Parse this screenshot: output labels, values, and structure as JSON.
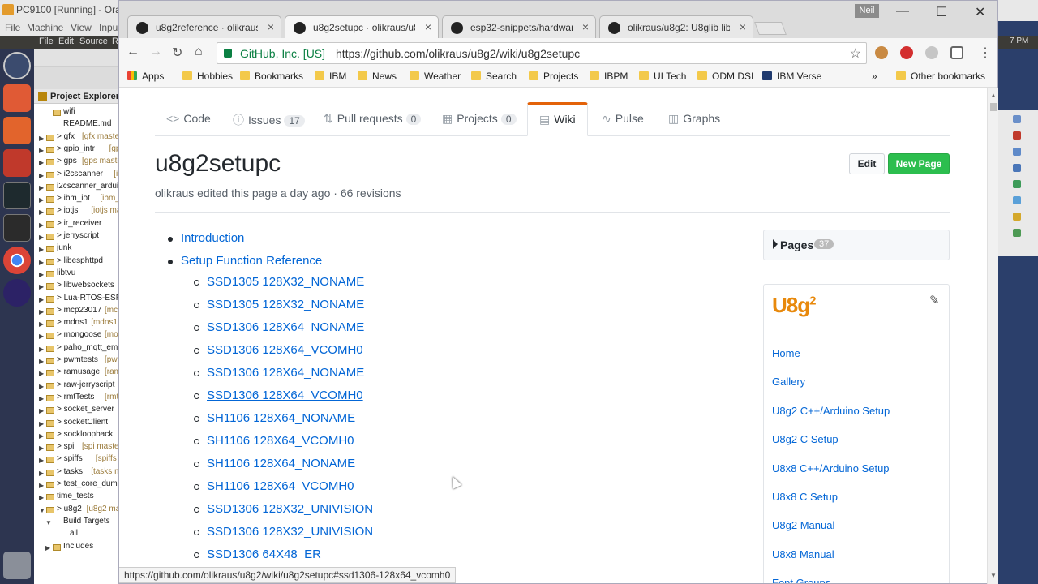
{
  "vm": {
    "title": "PC9100 [Running] - Ora",
    "menu": [
      "File",
      "Machine",
      "View",
      "Inpu"
    ]
  },
  "ubuntu_topbar": {
    "menu": [
      "File",
      "Edit",
      "Source",
      "R"
    ],
    "time": "7 PM"
  },
  "project_explorer": {
    "title": "Project Explorer",
    "items": [
      {
        "indent": 1,
        "twisty": "",
        "label": "wifi",
        "decoration": "",
        "folder": true
      },
      {
        "indent": 1,
        "twisty": "",
        "label": "README.md",
        "decoration": "",
        "folder": false
      },
      {
        "indent": 0,
        "twisty": ">",
        "label": "> gfx",
        "decoration": "[gfx master",
        "folder": true
      },
      {
        "indent": 0,
        "twisty": ">",
        "label": "> gpio_intr",
        "decoration": "[gpio",
        "folder": true
      },
      {
        "indent": 0,
        "twisty": ">",
        "label": "> gps",
        "decoration": "[gps maste",
        "folder": true
      },
      {
        "indent": 0,
        "twisty": ">",
        "label": "> i2cscanner",
        "decoration": "[i2c",
        "folder": true
      },
      {
        "indent": 0,
        "twisty": ">",
        "label": "i2cscanner_ardui",
        "decoration": "",
        "folder": true
      },
      {
        "indent": 0,
        "twisty": ">",
        "label": "> ibm_iot",
        "decoration": "[ibm_io",
        "folder": true
      },
      {
        "indent": 0,
        "twisty": ">",
        "label": "> iotjs",
        "decoration": "[iotjs mast",
        "folder": true
      },
      {
        "indent": 0,
        "twisty": ">",
        "label": "> ir_receiver",
        "decoration": "[ir_r",
        "folder": true
      },
      {
        "indent": 0,
        "twisty": ">",
        "label": "> jerryscript",
        "decoration": "[jerr",
        "folder": true
      },
      {
        "indent": 0,
        "twisty": ">",
        "label": "junk",
        "decoration": "",
        "folder": true
      },
      {
        "indent": 0,
        "twisty": ">",
        "label": "> libesphttpd",
        "decoration": "[lib",
        "folder": true
      },
      {
        "indent": 0,
        "twisty": ">",
        "label": "libtvu",
        "decoration": "",
        "folder": true
      },
      {
        "indent": 0,
        "twisty": ">",
        "label": "> libwebsockets",
        "decoration": "",
        "folder": true
      },
      {
        "indent": 0,
        "twisty": ">",
        "label": "> Lua-RTOS-ESP3",
        "decoration": "",
        "folder": true
      },
      {
        "indent": 0,
        "twisty": ">",
        "label": "> mcp23017",
        "decoration": "[mcp",
        "folder": true
      },
      {
        "indent": 0,
        "twisty": ">",
        "label": "> mdns1",
        "decoration": "[mdns1",
        "folder": true
      },
      {
        "indent": 0,
        "twisty": ">",
        "label": "> mongoose",
        "decoration": "[mo",
        "folder": true
      },
      {
        "indent": 0,
        "twisty": ">",
        "label": "> paho_mqtt_em",
        "decoration": "",
        "folder": true
      },
      {
        "indent": 0,
        "twisty": ">",
        "label": "> pwmtests",
        "decoration": "[pw",
        "folder": true
      },
      {
        "indent": 0,
        "twisty": ">",
        "label": "> ramusage",
        "decoration": "[ram",
        "folder": true
      },
      {
        "indent": 0,
        "twisty": ">",
        "label": "> raw-jerryscript",
        "decoration": "",
        "folder": true
      },
      {
        "indent": 0,
        "twisty": ">",
        "label": "> rmtTests",
        "decoration": "[rmtTe",
        "folder": true
      },
      {
        "indent": 0,
        "twisty": ">",
        "label": "> socket_server",
        "decoration": "[",
        "folder": true
      },
      {
        "indent": 0,
        "twisty": ">",
        "label": "> socketClient",
        "decoration": "[s",
        "folder": true
      },
      {
        "indent": 0,
        "twisty": ">",
        "label": "> sockloopback",
        "decoration": "[",
        "folder": true
      },
      {
        "indent": 0,
        "twisty": ">",
        "label": "> spi",
        "decoration": "[spi master]",
        "folder": true
      },
      {
        "indent": 0,
        "twisty": ">",
        "label": "> spiffs",
        "decoration": "[spiffs m",
        "folder": true
      },
      {
        "indent": 0,
        "twisty": ">",
        "label": "> tasks",
        "decoration": "[tasks ma",
        "folder": true
      },
      {
        "indent": 0,
        "twisty": ">",
        "label": "> test_core_dum",
        "decoration": "",
        "folder": true
      },
      {
        "indent": 0,
        "twisty": ">",
        "label": "time_tests",
        "decoration": "",
        "folder": true
      },
      {
        "indent": 0,
        "twisty": "v",
        "label": "> u8g2",
        "decoration": "[u8g2 mas",
        "folder": true
      },
      {
        "indent": 1,
        "twisty": "v",
        "label": "Build Targets",
        "decoration": "",
        "folder": false
      },
      {
        "indent": 2,
        "twisty": "",
        "label": "all",
        "decoration": "",
        "folder": false
      },
      {
        "indent": 1,
        "twisty": ">",
        "label": "Includes",
        "decoration": "",
        "folder": true
      }
    ]
  },
  "browser": {
    "profile_name": "Neil",
    "tabs": [
      {
        "title": "u8g2reference · olikraus",
        "active": false
      },
      {
        "title": "u8g2setupc · olikraus/u8",
        "active": true
      },
      {
        "title": "esp32-snippets/hardwar",
        "active": false
      },
      {
        "title": "olikraus/u8g2: U8glib lib",
        "active": false
      }
    ],
    "site_identity": "GitHub, Inc. [US]",
    "url": "https://github.com/olikraus/u8g2/wiki/u8g2setupc",
    "bookmarks": [
      {
        "label": "Apps",
        "folder": false
      },
      {
        "label": "Hobbies",
        "folder": true
      },
      {
        "label": "Bookmarks",
        "folder": true
      },
      {
        "label": "IBM",
        "folder": true
      },
      {
        "label": "News",
        "folder": true
      },
      {
        "label": "Weather",
        "folder": true
      },
      {
        "label": "Search",
        "folder": true
      },
      {
        "label": "Projects",
        "folder": true
      },
      {
        "label": "IBPM",
        "folder": true
      },
      {
        "label": "UI Tech",
        "folder": true
      },
      {
        "label": "ODM DSI",
        "folder": true
      },
      {
        "label": "IBM Verse",
        "folder": false
      }
    ],
    "bookmarks_overflow": "»",
    "other_bookmarks": "Other bookmarks",
    "status_url": "https://github.com/olikraus/u8g2/wiki/u8g2setupc#ssd1306-128x64_vcomh0"
  },
  "repo_nav": [
    {
      "icon": "<>",
      "label": "Code",
      "count": ""
    },
    {
      "icon": "ⓘ",
      "label": "Issues",
      "count": "17"
    },
    {
      "icon": "⇅",
      "label": "Pull requests",
      "count": "0"
    },
    {
      "icon": "▦",
      "label": "Projects",
      "count": "0"
    },
    {
      "icon": "▤",
      "label": "Wiki",
      "count": "",
      "active": true
    },
    {
      "icon": "∿",
      "label": "Pulse",
      "count": ""
    },
    {
      "icon": "▥",
      "label": "Graphs",
      "count": ""
    }
  ],
  "wiki": {
    "title": "u8g2setupc",
    "meta": "olikraus edited this page a day ago · 66 revisions",
    "edit_label": "Edit",
    "new_page_label": "New Page",
    "toc_top": [
      "Introduction",
      "Setup Function Reference"
    ],
    "toc_sub": [
      "SSD1305 128X32_NONAME",
      "SSD1305 128X32_NONAME",
      "SSD1306 128X64_NONAME",
      "SSD1306 128X64_VCOMH0",
      "SSD1306 128X64_NONAME",
      "SSD1306 128X64_VCOMH0",
      "SH1106 128X64_NONAME",
      "SH1106 128X64_VCOMH0",
      "SH1106 128X64_NONAME",
      "SH1106 128X64_VCOMH0",
      "SSD1306 128X32_UNIVISION",
      "SSD1306 128X32_UNIVISION",
      "SSD1306 64X48_ER"
    ],
    "hovered_index": 5
  },
  "wiki_sidebar": {
    "pages_label": "Pages",
    "pages_count": "37",
    "logo_text": "U8g",
    "logo_sup": "2",
    "links": [
      "Home",
      "Gallery",
      "U8g2 C++/Arduino Setup",
      "U8g2 C Setup",
      "U8x8 C++/Arduino Setup",
      "U8x8 C Setup",
      "U8g2 Manual",
      "U8x8 Manual",
      "Font Groups"
    ]
  },
  "colors": {
    "github_link": "#0366d6",
    "wiki_tab_accent": "#e36209",
    "new_page_green": "#2cbe4e",
    "ubuntu_launcher": "#2d3550",
    "secure_green": "#0b8043"
  }
}
